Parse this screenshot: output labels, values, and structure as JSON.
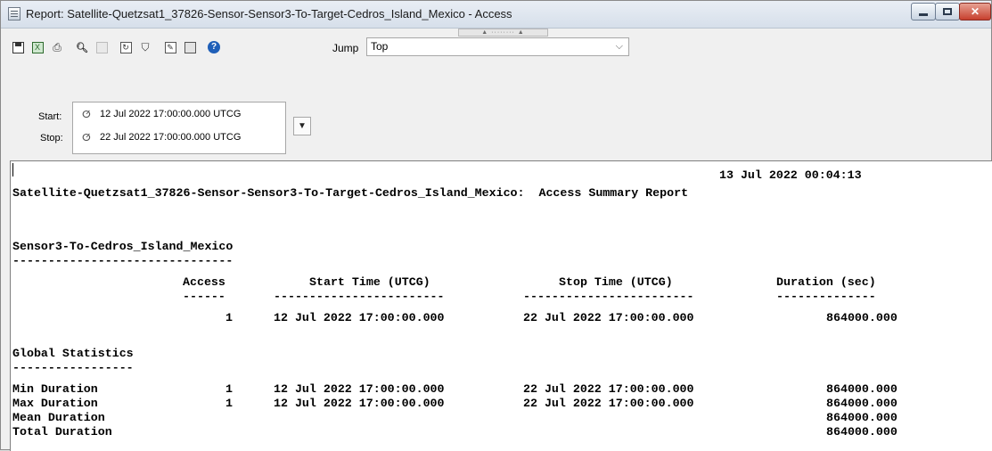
{
  "window": {
    "title": "Report: Satellite-Quetzsat1_37826-Sensor-Sensor3-To-Target-Cedros_Island_Mexico - Access"
  },
  "grip": {
    "label": "▲ ········ ▲"
  },
  "toolbar": {
    "buttons": [
      {
        "name": "save-icon"
      },
      {
        "name": "excel-icon"
      },
      {
        "name": "print-icon"
      },
      {
        "name": "find-icon"
      },
      {
        "name": "copy-icon"
      },
      {
        "name": "refresh-icon"
      },
      {
        "name": "filter-icon"
      },
      {
        "name": "style-icon"
      },
      {
        "name": "report-manager-icon"
      },
      {
        "name": "help-icon"
      }
    ],
    "jump_label": "Jump",
    "jump_value": "Top"
  },
  "time": {
    "start_label": "Start:",
    "start_value": "12 Jul 2022 17:00:00.000 UTCG",
    "stop_label": "Stop:",
    "stop_value": "22 Jul 2022 17:00:00.000 UTCG"
  },
  "report": {
    "timestamp": "13 Jul 2022 00:04:13",
    "title": "Satellite-Quetzsat1_37826-Sensor-Sensor3-To-Target-Cedros_Island_Mexico:  Access Summary Report",
    "section_name": "Sensor3-To-Cedros_Island_Mexico",
    "section_underline": "-------------------------------",
    "columns": {
      "access": "Access",
      "start": "Start Time (UTCG)",
      "stop": "Stop Time (UTCG)",
      "duration": "Duration (sec)"
    },
    "column_underlines": {
      "access": "------",
      "start": "------------------------",
      "stop": "------------------------",
      "duration": "--------------"
    },
    "rows": [
      {
        "access": "1",
        "start": "12 Jul 2022 17:00:00.000",
        "stop": "22 Jul 2022 17:00:00.000",
        "duration": "864000.000"
      }
    ],
    "global_title": "Global Statistics",
    "global_underline": "-----------------",
    "stats": [
      {
        "label": "Min Duration",
        "access": "1",
        "start": "12 Jul 2022 17:00:00.000",
        "stop": "22 Jul 2022 17:00:00.000",
        "duration": "864000.000"
      },
      {
        "label": "Max Duration",
        "access": "1",
        "start": "12 Jul 2022 17:00:00.000",
        "stop": "22 Jul 2022 17:00:00.000",
        "duration": "864000.000"
      },
      {
        "label": "Mean Duration",
        "access": "",
        "start": "",
        "stop": "",
        "duration": "864000.000"
      },
      {
        "label": "Total Duration",
        "access": "",
        "start": "",
        "stop": "",
        "duration": "864000.000"
      }
    ]
  }
}
